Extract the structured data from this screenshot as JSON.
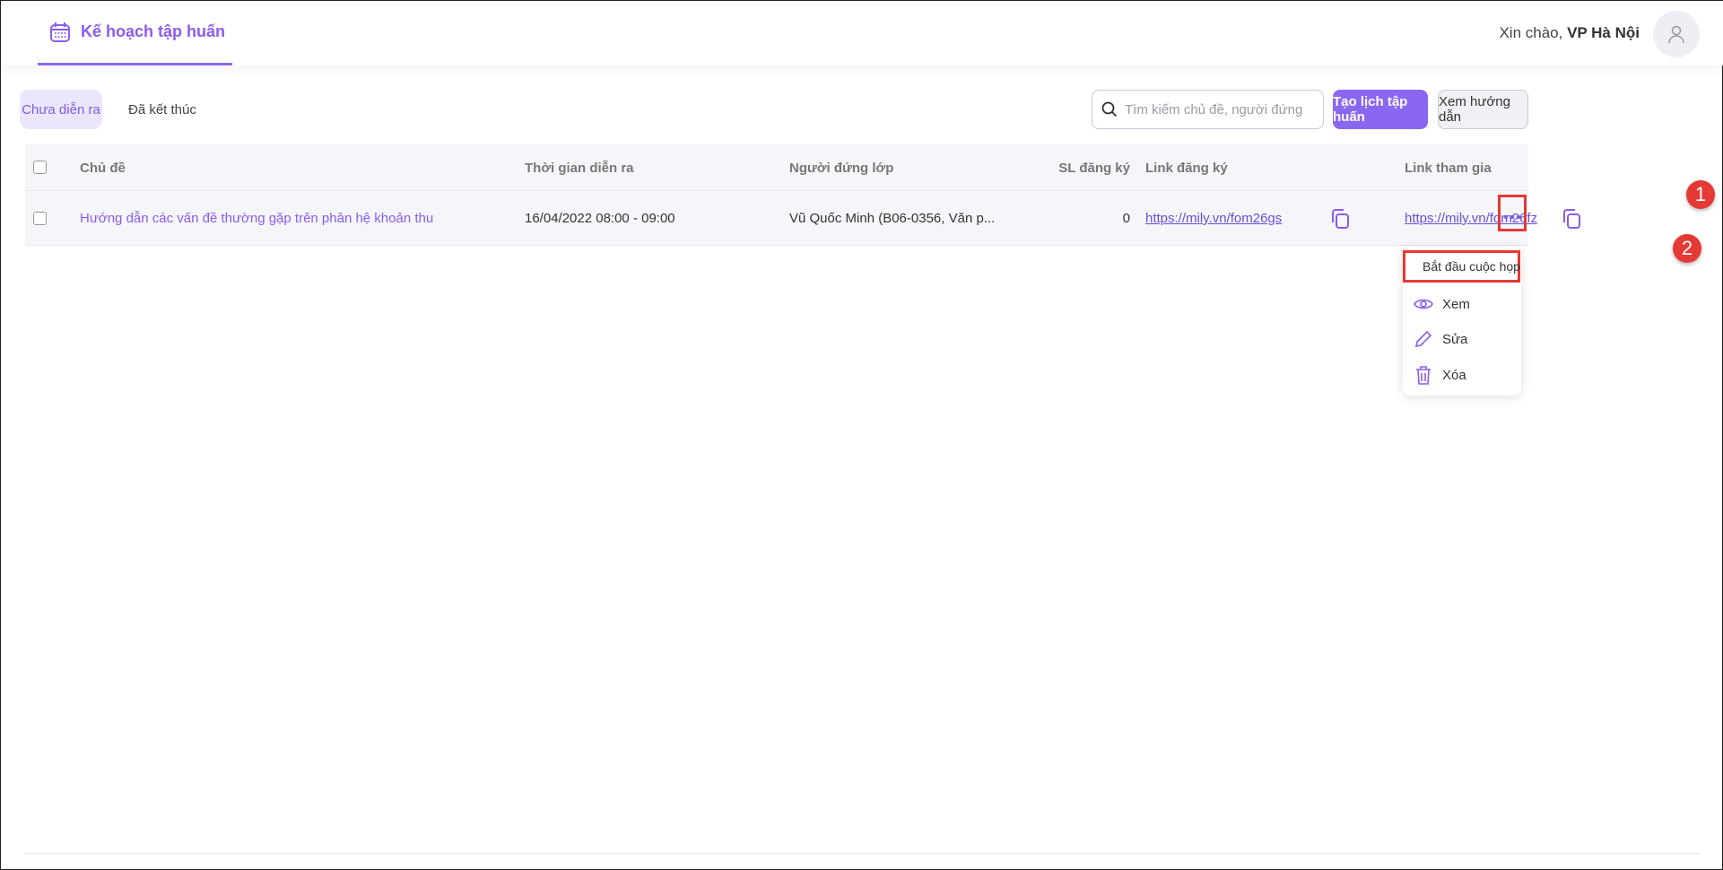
{
  "header": {
    "title": "Kế hoạch tập huấn",
    "greeting": "Xin chào, ",
    "user": "VP Hà Nội"
  },
  "tabs": [
    {
      "label": "Chưa diễn ra",
      "active": true
    },
    {
      "label": "Đã kết thúc",
      "active": false
    }
  ],
  "search": {
    "placeholder": "Tìm kiếm chủ đề, người đứng lớp",
    "value": ""
  },
  "buttons": {
    "create": "Tạo lịch tập huấn",
    "guide": "Xem hướng dẫn"
  },
  "table": {
    "columns": [
      "Chủ đề",
      "Thời gian diễn ra",
      "Người đứng lớp",
      "SL đăng ký",
      "Link đăng ký",
      "Link tham gia"
    ],
    "rows": [
      {
        "topic": "Hướng dẫn các vấn đề thường gặp trên phân hệ khoản thu",
        "time": "16/04/2022 08:00 - 09:00",
        "trainer": "Vũ Quốc Minh (B06-0356, Văn p...",
        "count": "0",
        "reg_link": "https://mily.vn/fom26gs",
        "join_link": "https://mily.vn/fom26fz"
      }
    ]
  },
  "menu": [
    {
      "label": "Bắt đầu cuộc họp",
      "icon": "video-icon"
    },
    {
      "label": "Xem",
      "icon": "eye-icon"
    },
    {
      "label": "Sửa",
      "icon": "pencil-icon"
    },
    {
      "label": "Xóa",
      "icon": "trash-icon"
    }
  ],
  "annotations": [
    "1",
    "2"
  ],
  "colors": {
    "accent": "#8a67f0",
    "annotation": "#e53935"
  }
}
